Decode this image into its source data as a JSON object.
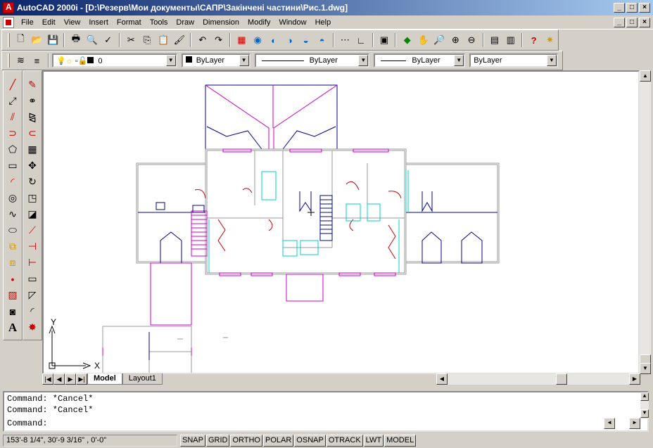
{
  "window": {
    "title": "AutoCAD 2000i - [D:\\Резерв\\Мои документы\\САПР\\Закінчені частини\\Рис.1.dwg]",
    "minimize": "_",
    "maximize": "□",
    "close": "×"
  },
  "menu": [
    "File",
    "Edit",
    "View",
    "Insert",
    "Format",
    "Tools",
    "Draw",
    "Dimension",
    "Modify",
    "Window",
    "Help"
  ],
  "standard_toolbar": {
    "icons": [
      "new-icon",
      "open-icon",
      "save-icon",
      "print-icon",
      "preview-icon",
      "spell-icon",
      "cut-icon",
      "copy-icon",
      "paste-icon",
      "matchprop-icon",
      "undo-icon",
      "redo-icon",
      "today-icon",
      "web-icon",
      "pan-icon",
      "zoom-realtime-icon",
      "help-icon"
    ]
  },
  "layer_toolbar": {
    "layer": "0",
    "color": "ByLayer",
    "linetype": "ByLayer",
    "lineweight": "ByLayer",
    "plotstyle": "ByLayer"
  },
  "ucs": {
    "y_label": "Y",
    "x_label": "X"
  },
  "tabs": {
    "model": "Model",
    "layout1": "Layout1"
  },
  "command": {
    "line1": "Command: *Cancel*",
    "line2": "Command: *Cancel*",
    "prompt": "Command:"
  },
  "status": {
    "coords": "153'-8 1/4\",  30'-9 3/16\" , 0'-0\"",
    "toggles": [
      "SNAP",
      "GRID",
      "ORTHO",
      "POLAR",
      "OSNAP",
      "OTRACK",
      "LWT",
      "MODEL"
    ]
  },
  "colors": {
    "title_start": "#0a246a",
    "wall": "#9a9a9a",
    "door": "#cc0000",
    "window": "#cc00cc",
    "furniture": "#00cccc",
    "outline": "#00008b"
  }
}
